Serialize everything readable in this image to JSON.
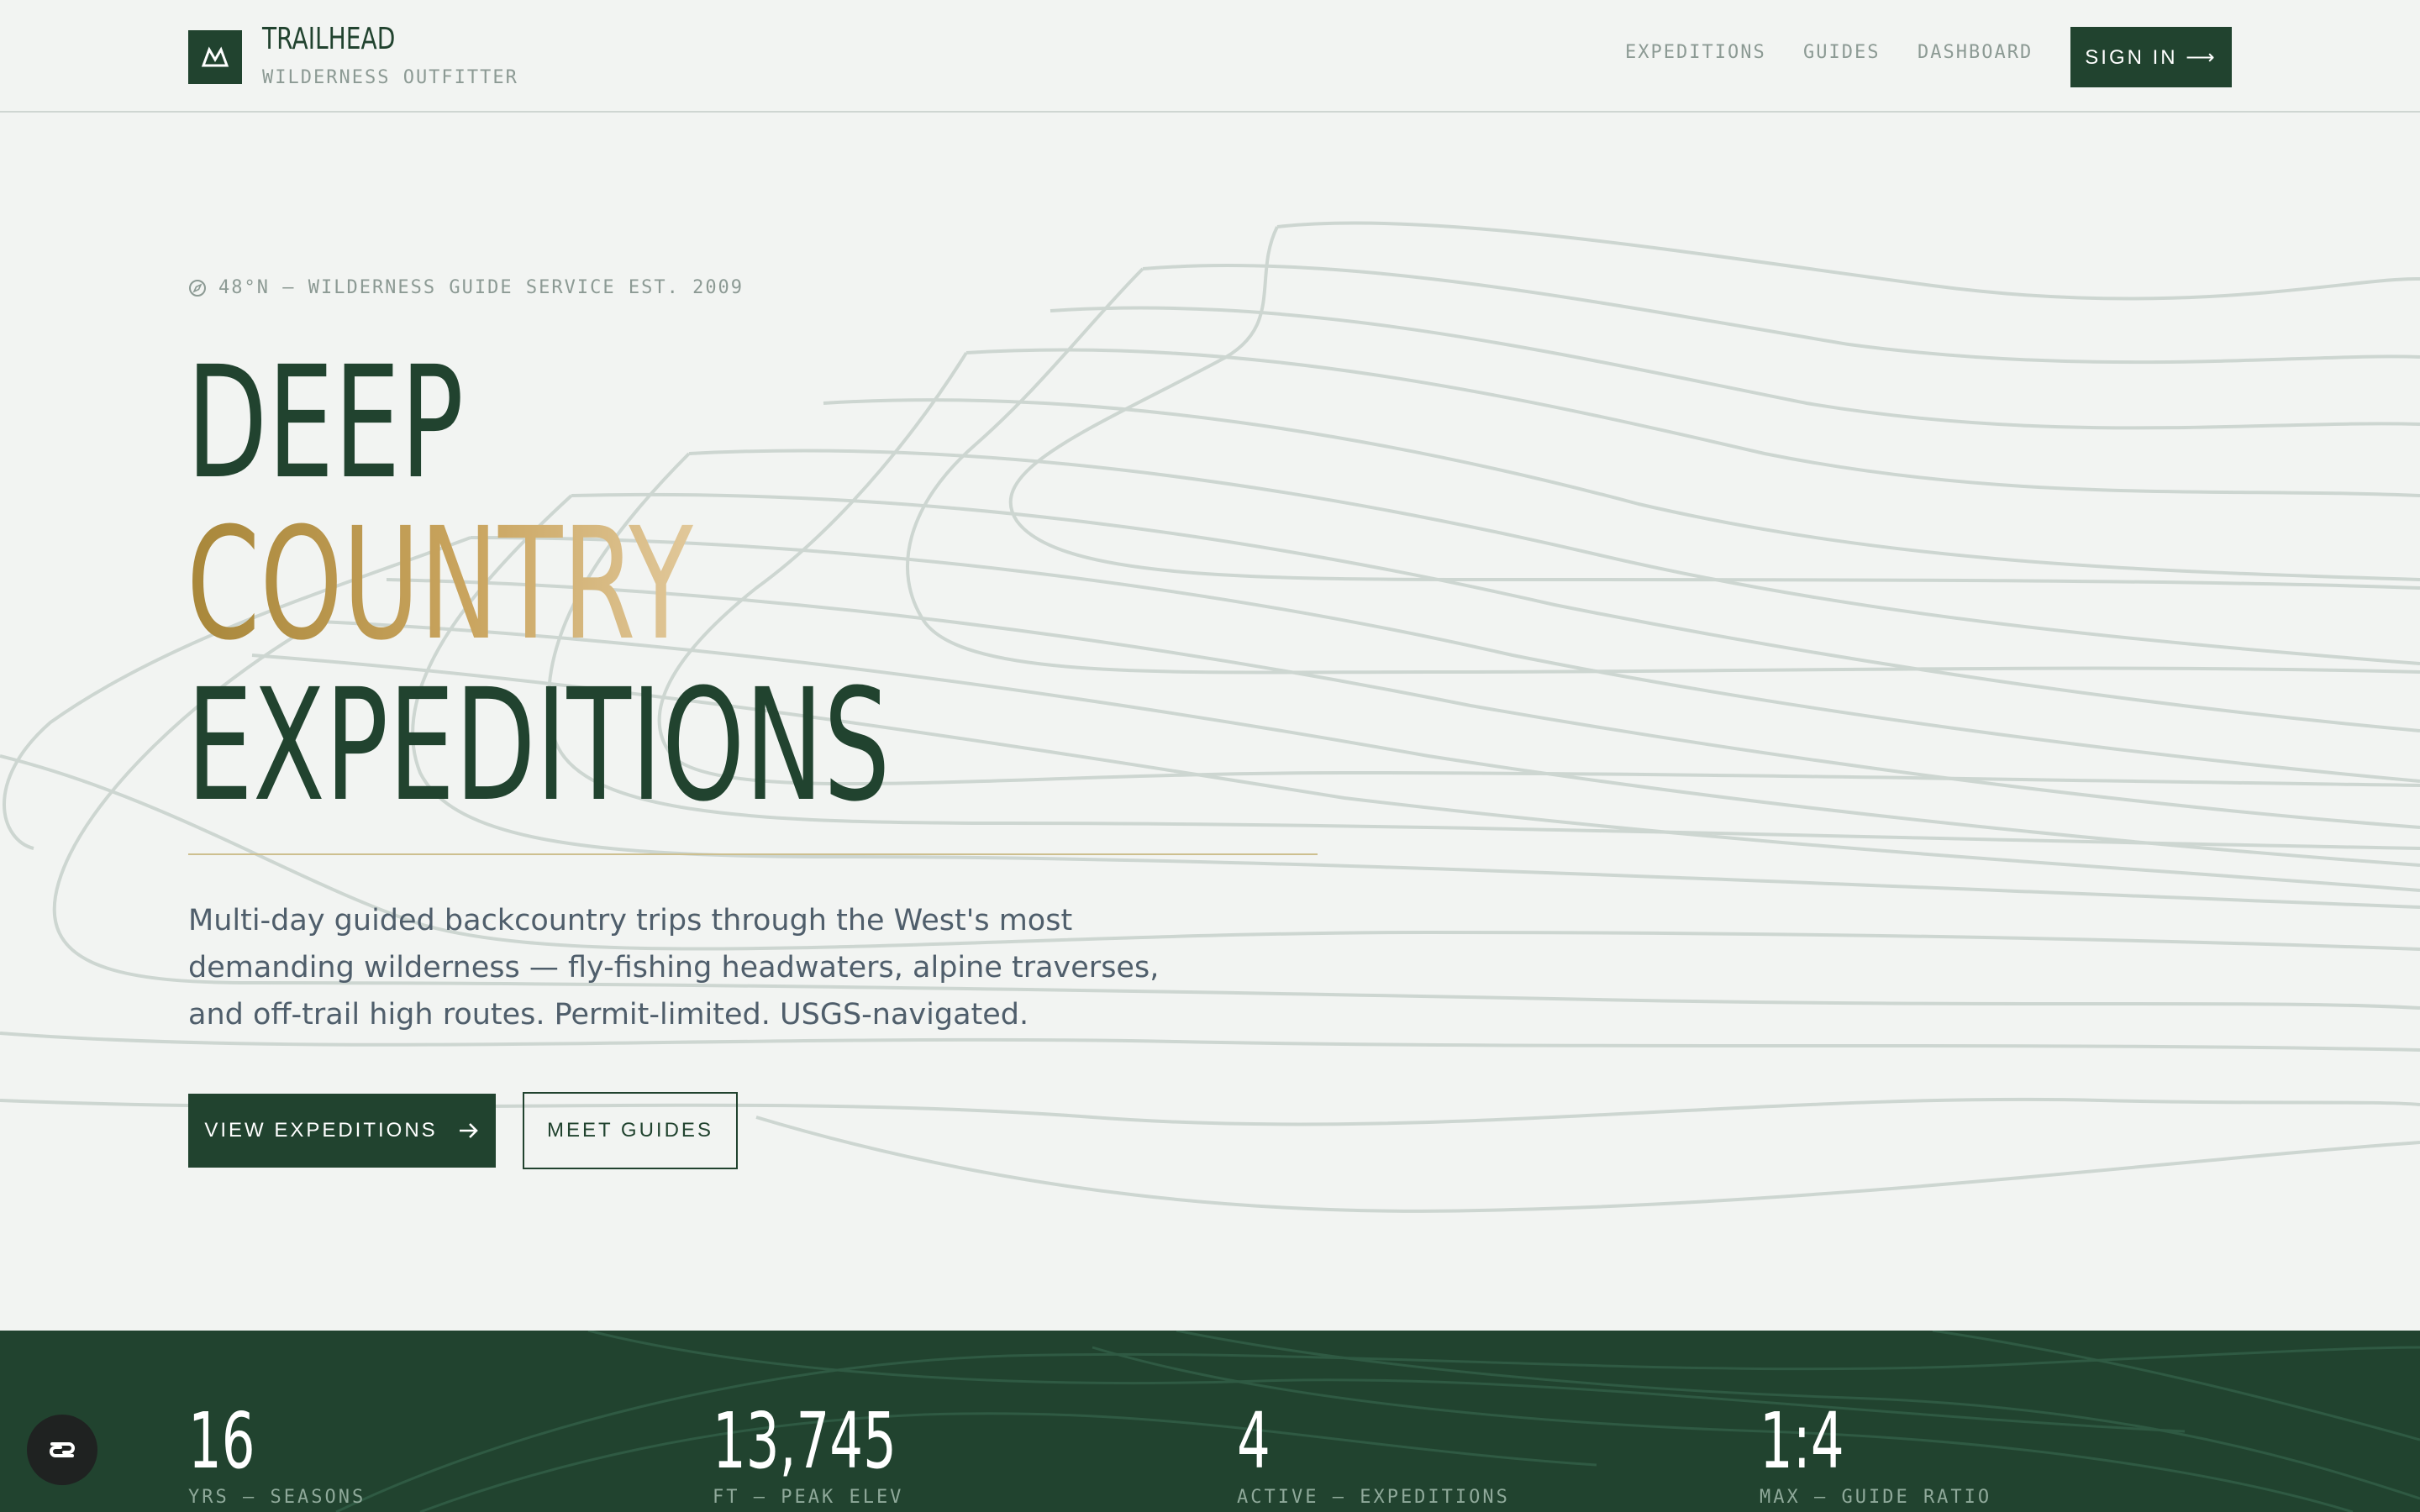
{
  "header": {
    "brand_name": "TRAILHEAD",
    "brand_sub": "WILDERNESS OUTFITTER",
    "nav": [
      {
        "label": "EXPEDITIONS"
      },
      {
        "label": "GUIDES"
      },
      {
        "label": "DASHBOARD"
      }
    ],
    "signin_label": "SIGN IN ⟶"
  },
  "hero": {
    "eyebrow": "48°N — WILDERNESS GUIDE SERVICE EST. 2009",
    "headline": [
      "DEEP",
      "COUNTRY",
      "EXPEDITIONS"
    ],
    "description": "Multi-day guided backcountry trips through the West's most demanding wilderness — fly-fishing headwaters, alpine traverses, and off-trail high routes. Permit-limited. USGS-navigated.",
    "primary_cta": "VIEW EXPEDITIONS",
    "secondary_cta": "MEET GUIDES"
  },
  "stats": [
    {
      "value": "16",
      "label": "YRS — SEASONS"
    },
    {
      "value": "13,745",
      "label": "FT — PEAK ELEV"
    },
    {
      "value": "4",
      "label": "ACTIVE — EXPEDITIONS"
    },
    {
      "value": "1:4",
      "label": "MAX — GUIDE RATIO"
    }
  ],
  "icons": {
    "logo": "mountain-icon",
    "eyebrow": "compass-icon",
    "cta_arrow": "arrow-right-icon",
    "chat": "chat-widget-icon"
  },
  "colors": {
    "brand_green": "#21432f",
    "gold_start": "#a8873a",
    "gold_end": "#e1c89a",
    "background": "#f2f4f2",
    "muted_text": "#8c9a94"
  }
}
